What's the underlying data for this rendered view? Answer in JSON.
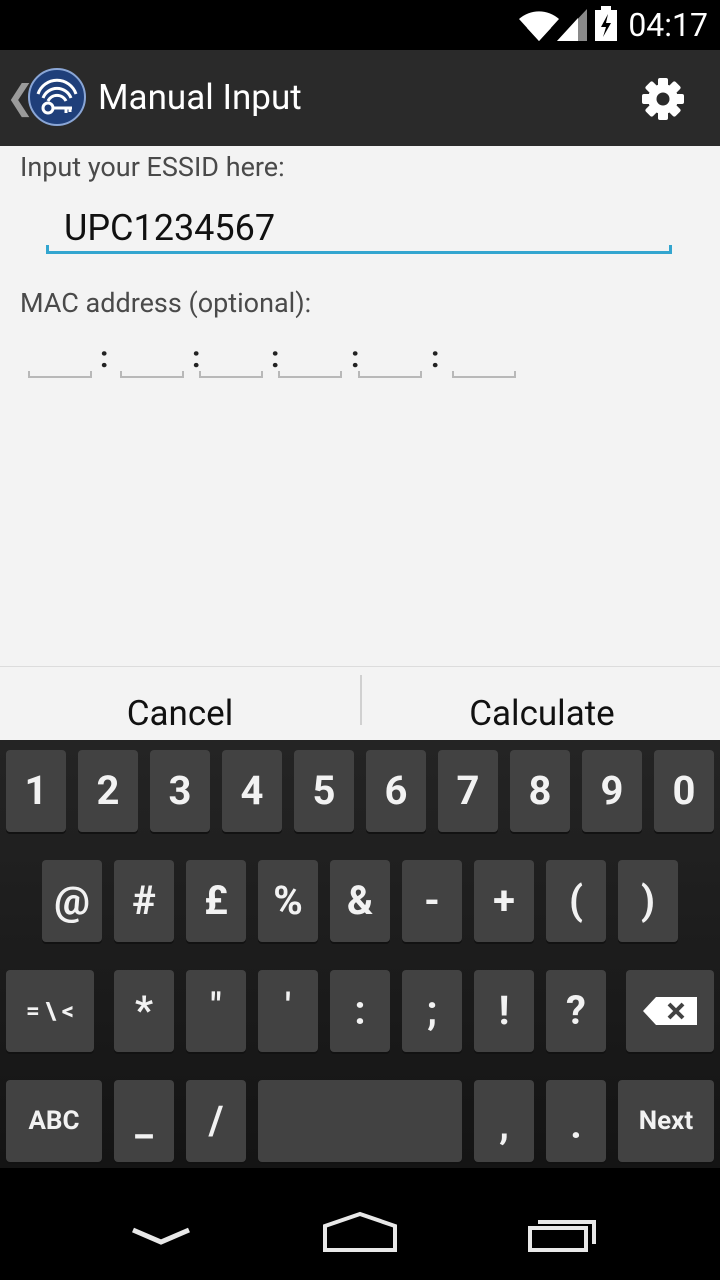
{
  "status_bar": {
    "time": "04:17",
    "icons": [
      "wifi-icon",
      "signal-icon",
      "battery-charging-icon"
    ]
  },
  "action_bar": {
    "title": "Manual Input",
    "icons": [
      "up-caret-icon",
      "app-logo-icon",
      "settings-gear-icon"
    ]
  },
  "form": {
    "essid_label": "Input your ESSID here:",
    "essid_value": "UPC1234567",
    "mac_label": "MAC address (optional):",
    "mac_fields": [
      "",
      "",
      "",
      "",
      "",
      ""
    ],
    "mac_separator": ":"
  },
  "buttons": {
    "cancel": "Cancel",
    "calculate": "Calculate"
  },
  "keyboard": {
    "row1": [
      "1",
      "2",
      "3",
      "4",
      "5",
      "6",
      "7",
      "8",
      "9",
      "0"
    ],
    "row2": [
      "@",
      "#",
      "£",
      "%",
      "&",
      "-",
      "+",
      "(",
      ")"
    ],
    "row3": [
      "= \\ <",
      "*",
      "\"",
      "'",
      ":",
      ";",
      "!",
      "?"
    ],
    "row3_delete_icon": "backspace-icon",
    "row4": {
      "abc": "ABC",
      "underscore": "_",
      "slash": "/",
      "comma": ",",
      "period": ".",
      "next": "Next"
    }
  },
  "nav_bar": {
    "icons": [
      "back-chevron-icon",
      "home-icon",
      "recents-icon"
    ]
  },
  "colors": {
    "accent": "#33a5cf",
    "action_bar": "#2a2a2a",
    "content_bg": "#f3f3f3",
    "key_bg": "#424242"
  }
}
